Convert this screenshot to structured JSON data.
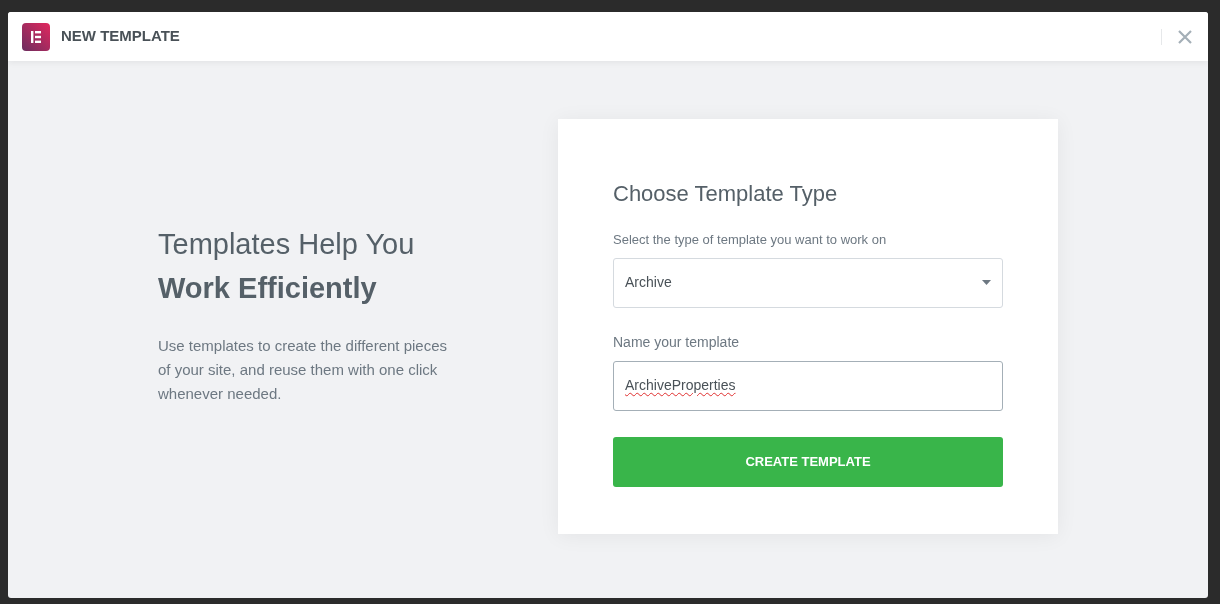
{
  "window": {
    "title": "NEW TEMPLATE"
  },
  "intro": {
    "heading": "Templates Help You",
    "heading_bold": "Work Efficiently",
    "text": "Use templates to create the different pieces of your site, and reuse them with one click whenever needed."
  },
  "form": {
    "title": "Choose Template Type",
    "type_label": "Select the type of template you want to work on",
    "type_value": "Archive",
    "name_label": "Name your template",
    "name_value": "ArchiveProperties",
    "submit": "CREATE TEMPLATE"
  }
}
